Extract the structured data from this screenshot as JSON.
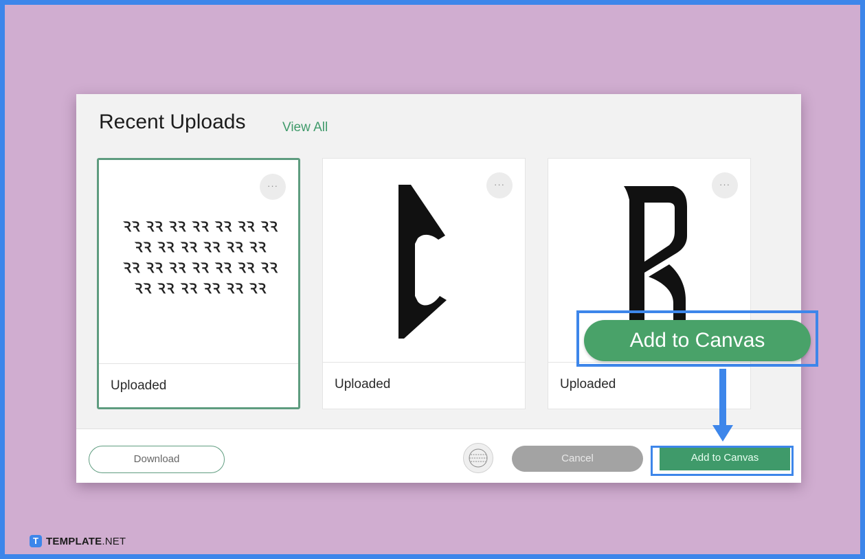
{
  "panel": {
    "title": "Recent Uploads",
    "view_all": "View All"
  },
  "cards": [
    {
      "label": "Uploaded",
      "more": "···",
      "thumb_icon": "monogram-alphabet-thumbnail",
      "monogram_rows": [
        "ꝚꝚ ꝚꝚ ꝚꝚ ꝚꝚ ꝚꝚ ꝚꝚ ꝚꝚ",
        "ꝚꝚ ꝚꝚ ꝚꝚ ꝚꝚ ꝚꝚ ꝚꝚ",
        "ꝚꝚ ꝚꝚ ꝚꝚ ꝚꝚ ꝚꝚ ꝚꝚ ꝚꝚ",
        "ꝚꝚ ꝚꝚ ꝚꝚ ꝚꝚ ꝚꝚ ꝚꝚ"
      ]
    },
    {
      "label": "Uploaded",
      "more": "···",
      "thumb_icon": "letter-c-thumbnail"
    },
    {
      "label": "Uploaded",
      "more": "···",
      "thumb_icon": "letter-r-thumbnail"
    }
  ],
  "footer": {
    "download": "Download",
    "cancel": "Cancel",
    "add_to_canvas": "Add to Canvas"
  },
  "callout": {
    "add_to_canvas": "Add to Canvas"
  },
  "brand": {
    "name_bold": "TEMPLATE",
    "name_light": ".NET",
    "logo_letter": "T"
  },
  "colors": {
    "background": "#d0add0",
    "frame": "#3d86ea",
    "accent_green": "#3f9a6a",
    "cancel_gray": "#a3a3a3"
  }
}
